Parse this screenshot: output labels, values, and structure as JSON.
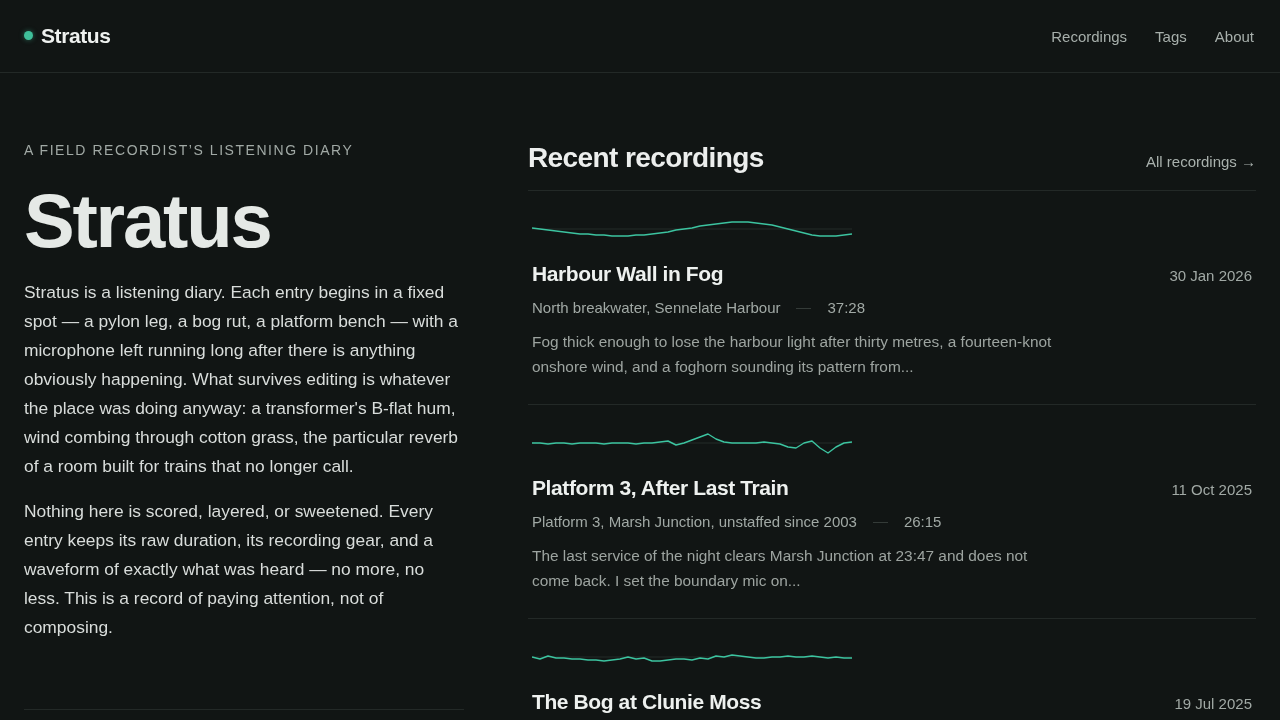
{
  "header": {
    "brand": "Stratus",
    "nav": [
      {
        "label": "Recordings"
      },
      {
        "label": "Tags"
      },
      {
        "label": "About"
      }
    ]
  },
  "intro": {
    "eyebrow": "A FIELD RECORDIST’S LISTENING DIARY",
    "title": "Stratus",
    "paragraphs": [
      "Stratus is a listening diary. Each entry begins in a fixed spot — a pylon leg, a bog rut, a platform bench — with a microphone left running long after there is anything obviously happening. What survives editing is whatever the place was doing anyway: a transformer's B-flat hum, wind combing through cotton grass, the particular reverb of a room built for trains that no longer call.",
      "Nothing here is scored, layered, or sweetened. Every entry keeps its raw duration, its recording gear, and a waveform of exactly what was heard — no more, no less. This is a record of paying attention, not of composing."
    ]
  },
  "recent": {
    "heading": "Recent recordings",
    "all_link": "All recordings →",
    "entries": [
      {
        "title": "Harbour Wall in Fog",
        "date": "30 Jan 2026",
        "location": "North breakwater, Sennelate Harbour",
        "duration": "37:28",
        "excerpt": "Fog thick enough to lose the harbour light after thirty metres, a fourteen-knot onshore wind, and a foghorn sounding its pattern from..."
      },
      {
        "title": "Platform 3, After Last Train",
        "date": "11 Oct 2025",
        "location": "Platform 3, Marsh Junction, unstaffed since 2003",
        "duration": "26:15",
        "excerpt": "The last service of the night clears Marsh Junction at 23:47 and does not come back. I set the boundary mic on..."
      },
      {
        "title": "The Bog at Clunie Moss",
        "date": "19 Jul 2025"
      }
    ]
  }
}
